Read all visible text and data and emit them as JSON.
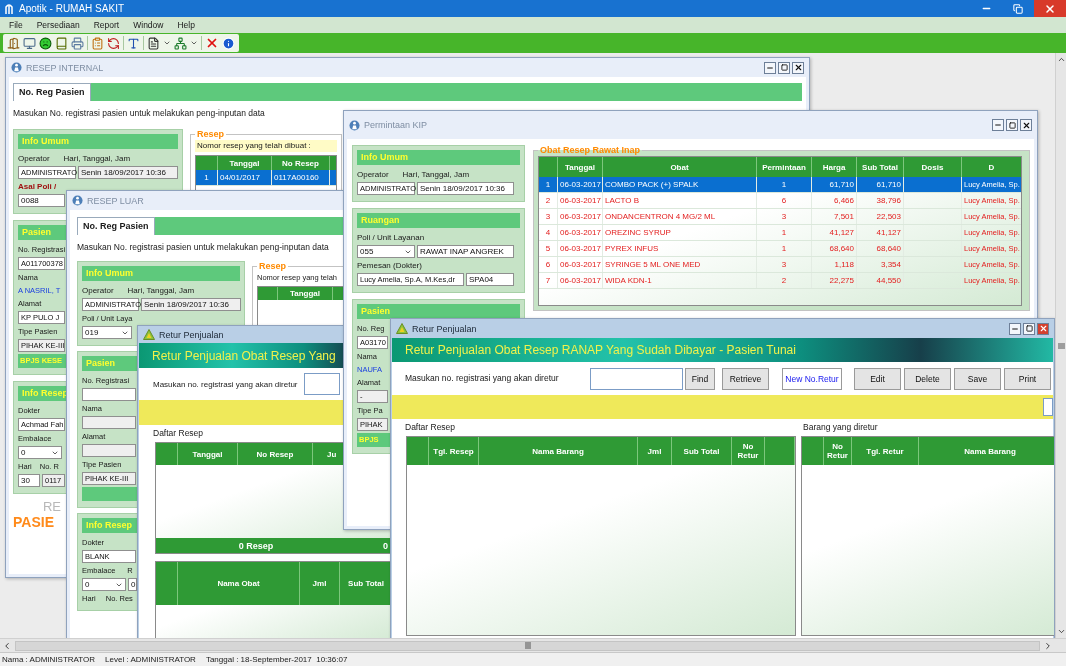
{
  "app": {
    "title": "Apotik - RUMAH SAKIT"
  },
  "menu": [
    {
      "label": "File"
    },
    {
      "label": "Persediaan"
    },
    {
      "label": "Report"
    },
    {
      "label": "Window"
    },
    {
      "label": "Help"
    }
  ],
  "resep_internal": {
    "title": "RESEP INTERNAL",
    "tab": "No. Reg Pasien",
    "instruction": "Masukan No. registrasi pasien untuk melakukan peng-inputan data",
    "info_umum": {
      "title": "Info Umum",
      "operator_label": "Operator",
      "datetime_label": "Hari, Tanggal, Jam",
      "operator": "ADMINISTRATO",
      "datetime": "Senin 18/09/2017 10:36"
    },
    "asal_poli": {
      "label": "Asal Poli /",
      "value": "0088"
    },
    "pasien": {
      "title": "Pasien",
      "no_registrasi_label": "No. Registrasi",
      "no_registrasi": "A011700378",
      "nama_label": "Nama",
      "nama": "A NASRIL, T",
      "alamat_label": "Alamat",
      "alamat": "KP PULO J",
      "tipe_label": "Tipe Pasien",
      "tipe": "PIHAK KE-III",
      "jaminan": "BPJS KESE"
    },
    "info_resep": {
      "title": "Info Resep",
      "dokter_label": "Dokter",
      "dokter": "Achmad Fah",
      "embalace_label": "Embalace",
      "embalace": "0",
      "hari_label": "Hari",
      "no_resep_label": "No. R",
      "hari": "30",
      "no_resep": "0117"
    },
    "footer": {
      "caption": "RE",
      "banner": "PASIE"
    },
    "resep": {
      "title": "Resep",
      "note": "Nomor resep yang telah dibuat :",
      "columns": [
        "Tanggal",
        "No Resep"
      ],
      "rows": [
        {
          "no": "1",
          "tanggal": "04/01/2017",
          "no_resep": "0117A00160",
          "selected": true
        }
      ]
    }
  },
  "resep_luar": {
    "title": "RESEP LUAR",
    "tab": "No. Reg Pasien",
    "instruction": "Masukan No. registrasi pasien untuk melakukan peng-inputan data",
    "info_umum": {
      "title": "Info Umum",
      "operator_label": "Operator",
      "datetime_label": "Hari, Tanggal, Jam",
      "operator": "ADMINISTRATO",
      "datetime": "Senin 18/09/2017 10:36",
      "poli_label": "Poli / Unit Laya",
      "poli": "019"
    },
    "pasien": {
      "title": "Pasien",
      "no_registrasi_label": "No. Registrasi",
      "nama_label": "Nama",
      "alamat_label": "Alamat",
      "tipe_label": "Tipe Pasien",
      "tipe": "PIHAK KE-III"
    },
    "info_resep": {
      "title": "Info Resep",
      "dokter_label": "Dokter",
      "dokter": "BLANK",
      "embalace_label": "Embalace",
      "racikan_label": "R",
      "embalace": "0",
      "racikan": "0",
      "hari_label": "Hari",
      "no_resep_label": "No. Res"
    },
    "resep": {
      "title": "Resep",
      "note": "Nomor resep yang telah",
      "columns": [
        "Tanggal"
      ]
    }
  },
  "retur_penjualan_1": {
    "title": "Retur Penjualan",
    "heading": "Retur Penjualan Obat Resep Yang",
    "prompt": "Masukan no. registrasi yang akan diretur",
    "list_label": "Daftar Resep",
    "columns": [
      "Tanggal",
      "No Resep",
      "Ju"
    ],
    "summary": [
      "0 Resep",
      "0"
    ],
    "detail_columns": [
      "Nama Obat",
      "Jml",
      "Sub Total"
    ]
  },
  "permintaan_kip": {
    "title": "Permintaan KIP",
    "info_umum": {
      "title": "Info Umum",
      "operator_label": "Operator",
      "datetime_label": "Hari, Tanggal, Jam",
      "operator": "ADMINISTRATO",
      "datetime": "Senin 18/09/2017 10:36"
    },
    "ruangan": {
      "title": "Ruangan",
      "poli_label": "Poli / Unit Layanan",
      "poli_code": "055",
      "poli_name": "RAWAT INAP ANGREK",
      "pemesan_label": "Pemesan (Dokter)",
      "pemesan": "Lucy Amelia, Sp.A, M.Kes,dr",
      "pemesan_code": "SPA04"
    },
    "pasien": {
      "title": "Pasien",
      "no_registrasi_label": "No. Reg",
      "no_registrasi": "A03170",
      "nama_label": "Nama",
      "nama": "NAUFA",
      "alamat_label": "Alamat",
      "alamat": "-",
      "tipe_label": "Tipe Pa",
      "tipe": "PIHAK",
      "jaminan": "BPJS"
    },
    "group_title": "Obat Resep Rawat Inap",
    "columns": [
      "Tanggal",
      "Obat",
      "Permintaan",
      "Harga",
      "Sub Total",
      "Dosis",
      "D"
    ],
    "rows": [
      {
        "no": "1",
        "tanggal": "06-03-2017",
        "obat": "COMBO PACK (+) SPALK",
        "permintaan": "1",
        "harga": "61,710",
        "sub_total": "61,710",
        "dokter": "Lucy Amelia, Sp.",
        "selected": true
      },
      {
        "no": "2",
        "tanggal": "06-03-2017",
        "obat": "LACTO B",
        "permintaan": "6",
        "harga": "6,466",
        "sub_total": "38,796",
        "dokter": "Lucy Amelia, Sp.",
        "selected": false
      },
      {
        "no": "3",
        "tanggal": "06-03-2017",
        "obat": "ONDANCENTRON 4 MG/2 ML",
        "permintaan": "3",
        "harga": "7,501",
        "sub_total": "22,503",
        "dokter": "Lucy Amelia, Sp.",
        "selected": false
      },
      {
        "no": "4",
        "tanggal": "06-03-2017",
        "obat": "OREZINC SYRUP",
        "permintaan": "1",
        "harga": "41,127",
        "sub_total": "41,127",
        "dokter": "Lucy Amelia, Sp.",
        "selected": false
      },
      {
        "no": "5",
        "tanggal": "06-03-2017",
        "obat": "PYREX INFUS",
        "permintaan": "1",
        "harga": "68,640",
        "sub_total": "68,640",
        "dokter": "Lucy Amelia, Sp.",
        "selected": false
      },
      {
        "no": "6",
        "tanggal": "06-03-2017",
        "obat": "SYRINGE 5 ML ONE MED",
        "permintaan": "3",
        "harga": "1,118",
        "sub_total": "3,354",
        "dokter": "Lucy Amelia, Sp.",
        "selected": false
      },
      {
        "no": "7",
        "tanggal": "06-03-2017",
        "obat": "WIDA KDN-1",
        "permintaan": "2",
        "harga": "22,275",
        "sub_total": "44,550",
        "dokter": "Lucy Amelia, Sp.",
        "selected": false
      }
    ]
  },
  "retur_penjualan_2": {
    "title": "Retur Penjualan",
    "heading": "Retur Penjualan Obat Resep RANAP Yang Sudah Dibayar - Pasien Tunai",
    "prompt": "Masukan no. registrasi yang akan diretur",
    "find": "Find",
    "retrieve": "Retrieve",
    "new_retur": "New No.Retur",
    "actions": [
      "Edit",
      "Delete",
      "Save",
      "Print"
    ],
    "list_label": "Daftar Resep",
    "returned_label": "Barang yang diretur",
    "columns": [
      "Tgl. Resep",
      "Nama Barang",
      "Jml",
      "Sub Total",
      "No Retur"
    ],
    "returned_columns": [
      "No Retur",
      "Tgl. Retur",
      "Nama Barang"
    ]
  },
  "status_bar": [
    "Nama : ADMINISTRATOR",
    "Level : ADMINISTRATOR",
    "Tanggal : 18-September-2017  10:36:07"
  ]
}
